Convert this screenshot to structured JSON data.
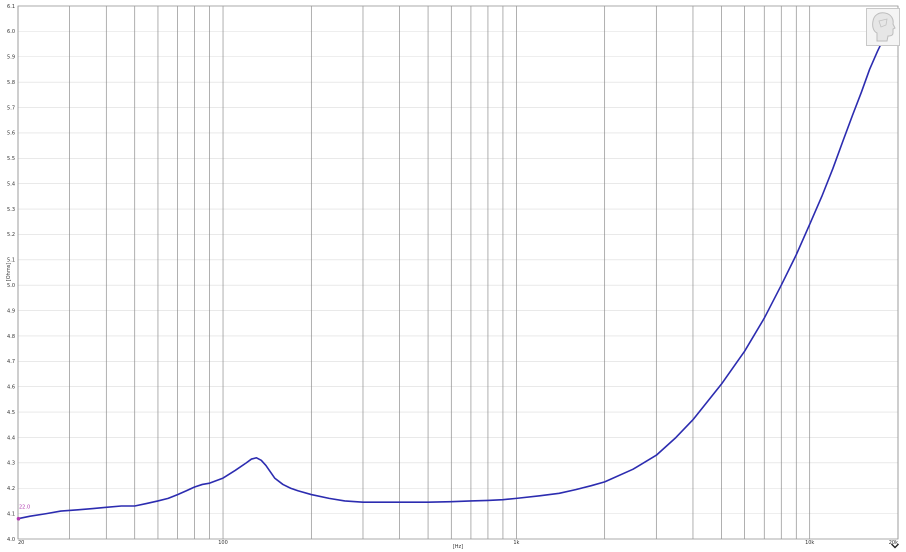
{
  "chart_data": {
    "type": "line",
    "xscale": "log",
    "xlim": [
      20,
      20000
    ],
    "ylim": [
      4.0,
      6.1
    ],
    "xlabel": "[Hz]",
    "ylabel": "[Ohms]",
    "grid": true,
    "x_ticks": [
      {
        "value": 20,
        "label": "20"
      },
      {
        "value": 100,
        "label": "100"
      },
      {
        "value": 1000,
        "label": "1k"
      },
      {
        "value": 10000,
        "label": "10k"
      },
      {
        "value": 20000,
        "label": "20k"
      }
    ],
    "x_gridlines": [
      20,
      30,
      40,
      50,
      60,
      70,
      80,
      90,
      100,
      200,
      300,
      400,
      500,
      600,
      700,
      800,
      900,
      1000,
      2000,
      3000,
      4000,
      5000,
      6000,
      7000,
      8000,
      9000,
      10000,
      20000
    ],
    "y_ticks": [
      "4.0",
      "4.1",
      "4.2",
      "4.3",
      "4.4",
      "4.5",
      "4.6",
      "4.7",
      "4.8",
      "4.9",
      "5.0",
      "5.1",
      "5.2",
      "5.3",
      "5.4",
      "5.5",
      "5.6",
      "5.7",
      "5.8",
      "5.9",
      "6.0",
      "6.1"
    ],
    "series": [
      {
        "color": "#2c2cb0",
        "x": [
          20,
          22,
          25,
          28,
          32,
          36,
          40,
          45,
          50,
          55,
          60,
          65,
          70,
          75,
          80,
          85,
          90,
          100,
          110,
          120,
          125,
          130,
          135,
          140,
          150,
          160,
          170,
          180,
          200,
          230,
          260,
          300,
          350,
          400,
          500,
          600,
          700,
          800,
          900,
          1000,
          1200,
          1400,
          1600,
          1800,
          2000,
          2500,
          3000,
          3500,
          4000,
          5000,
          6000,
          7000,
          8000,
          9000,
          10000,
          11000,
          12000,
          13000,
          14000,
          15000,
          16000,
          17000,
          18000,
          19000,
          20000
        ],
        "y": [
          4.08,
          4.09,
          4.1,
          4.11,
          4.115,
          4.12,
          4.125,
          4.13,
          4.13,
          4.14,
          4.15,
          4.16,
          4.175,
          4.19,
          4.205,
          4.215,
          4.22,
          4.24,
          4.27,
          4.3,
          4.315,
          4.32,
          4.31,
          4.29,
          4.24,
          4.215,
          4.2,
          4.19,
          4.175,
          4.16,
          4.15,
          4.145,
          4.145,
          4.145,
          4.145,
          4.147,
          4.15,
          4.152,
          4.155,
          4.16,
          4.17,
          4.18,
          4.195,
          4.21,
          4.225,
          4.275,
          4.33,
          4.4,
          4.47,
          4.61,
          4.74,
          4.87,
          5.0,
          5.12,
          5.24,
          5.35,
          5.46,
          5.57,
          5.67,
          5.76,
          5.85,
          5.92,
          5.98,
          6.03,
          6.075
        ]
      }
    ],
    "marker_label": "22.0"
  }
}
